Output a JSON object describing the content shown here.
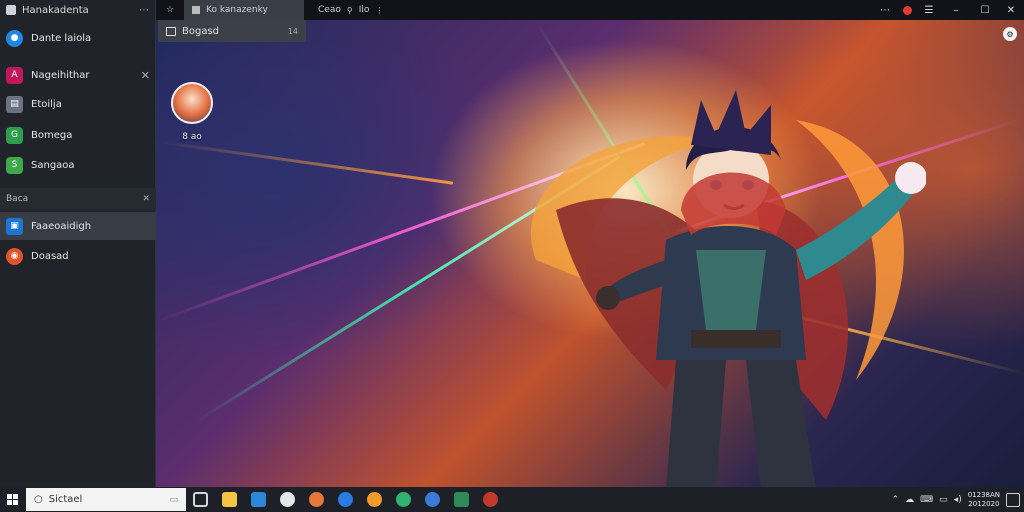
{
  "window": {
    "title": "Hanakadenta",
    "menu_glyph": "⋯"
  },
  "tabs": [
    {
      "label": "Ko kanazenky",
      "icon": "star-icon",
      "active": true
    },
    {
      "label": "Ceao",
      "icon": "tab-icon"
    },
    {
      "label": "Ilo",
      "icon": "tab-icon"
    }
  ],
  "dropdown": {
    "label": "Bogasd",
    "count": "14"
  },
  "sidebar": {
    "items": [
      {
        "label": "Dante laiola",
        "icon": "circle-blue-icon",
        "color": "#1e88e5"
      },
      {
        "label": "Nageihithar",
        "icon": "app-red-icon",
        "color": "#c2185b",
        "closable": true
      },
      {
        "label": "Etoilja",
        "icon": "app-gray-icon",
        "color": "#6b7280"
      },
      {
        "label": "Bomega",
        "icon": "app-green-icon",
        "color": "#2e9e4d"
      },
      {
        "label": "Sangaoa",
        "icon": "app-green2-icon",
        "color": "#3fa84a"
      }
    ],
    "section": {
      "label": "Baca"
    },
    "section_items": [
      {
        "label": "Faaeoaidigh",
        "icon": "app-blue-icon",
        "color": "#1976d2",
        "active": true
      },
      {
        "label": "Doasad",
        "icon": "app-orange-icon",
        "color": "#e0542b"
      }
    ]
  },
  "desktop": {
    "icon_label": "8 ao"
  },
  "taskbar": {
    "search_placeholder": "Sictael",
    "apps": [
      {
        "icon": "task-view-icon",
        "color": "#cfd8dc"
      },
      {
        "icon": "folder-icon",
        "color": "#f4c542"
      },
      {
        "icon": "store-icon",
        "color": "#2b88d8"
      },
      {
        "icon": "chat-icon",
        "color": "#e6e6e6"
      },
      {
        "icon": "browser-orange-icon",
        "color": "#e8773a"
      },
      {
        "icon": "edge-icon",
        "color": "#2a7be4"
      },
      {
        "icon": "firefox-icon",
        "color": "#f29a2b"
      },
      {
        "icon": "chrome-icon",
        "color": "#2fb36e"
      },
      {
        "icon": "shield-icon",
        "color": "#3b7bd8"
      },
      {
        "icon": "security-icon",
        "color": "#2e8b57"
      },
      {
        "icon": "game-icon",
        "color": "#c0392b"
      }
    ],
    "clock_time": "01238AN",
    "clock_date": "2012020"
  }
}
